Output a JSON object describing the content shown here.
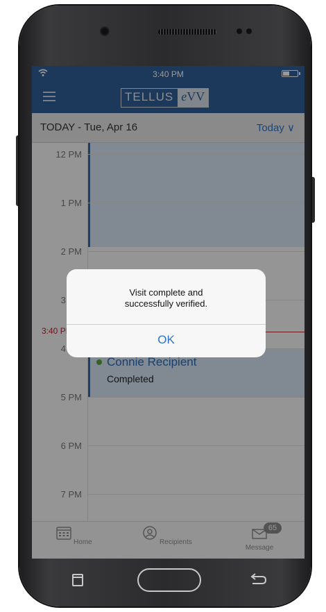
{
  "status_bar": {
    "time": "3:40 PM"
  },
  "navbar": {
    "logo_left": "TELLUS",
    "logo_right_italic": "e",
    "logo_right": "VV"
  },
  "datebar": {
    "title": "TODAY - Tue, Apr 16",
    "today_button": "Today ∨"
  },
  "calendar": {
    "hours": [
      "12 PM",
      "1 PM",
      "2 PM",
      "3 PM",
      "4 PM",
      "5 PM",
      "6 PM",
      "7 PM"
    ],
    "now_label": "3:40 PM",
    "event": {
      "title": "Connie Recipient",
      "status": "Completed",
      "status_color": "#5aa33a"
    }
  },
  "alert": {
    "message_line1": "Visit complete and",
    "message_line2": "successfully verified.",
    "ok_label": "OK"
  },
  "tabbar": {
    "home_label": "Home",
    "recipients_label": "Recipients",
    "message_label": "Message",
    "message_badge": "65"
  },
  "colors": {
    "brand": "#2f5f98",
    "accent": "#2e74c9",
    "now_line": "#b3232f"
  }
}
